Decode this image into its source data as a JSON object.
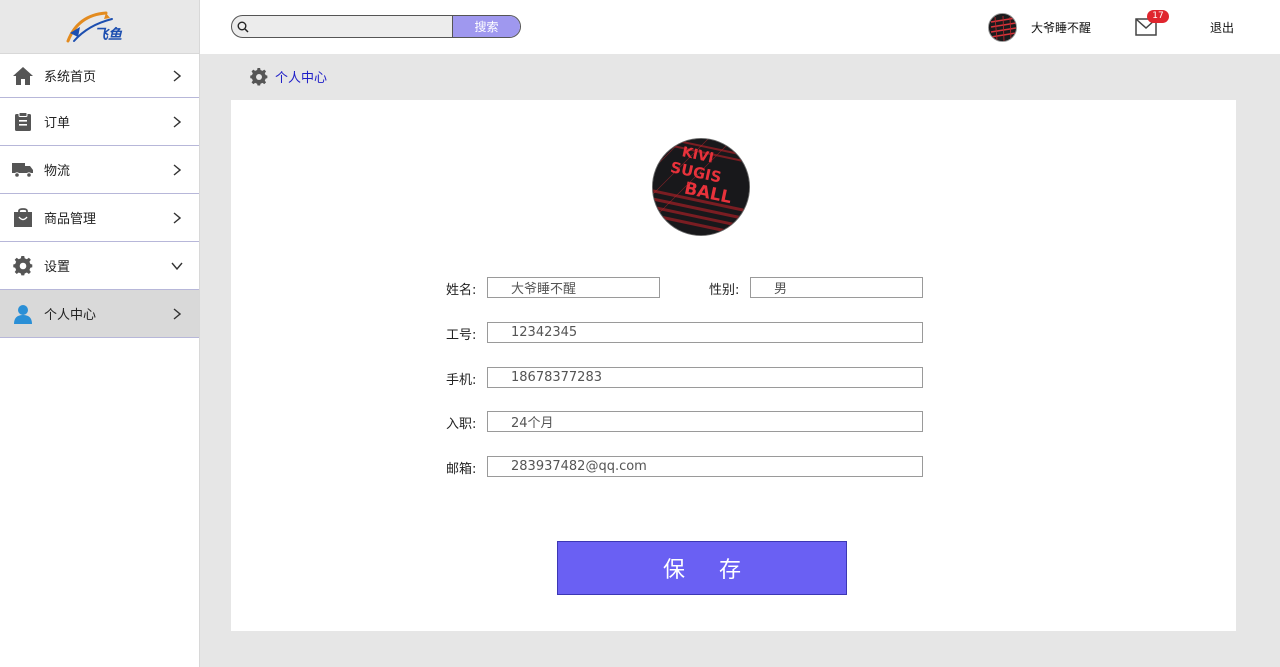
{
  "brand": {
    "logo_text": "飞鱼",
    "logo_colors": {
      "orange": "#e38b1f",
      "blue": "#1d4fb0"
    }
  },
  "sidebar": {
    "items": [
      {
        "label": "系统首页",
        "icon": "home-icon",
        "chevron": "right"
      },
      {
        "label": "订单",
        "icon": "clipboard-icon",
        "chevron": "right"
      },
      {
        "label": "物流",
        "icon": "truck-icon",
        "chevron": "right"
      },
      {
        "label": "商品管理",
        "icon": "shopping-bag-icon",
        "chevron": "right"
      },
      {
        "label": "设置",
        "icon": "gear-icon",
        "chevron": "down"
      },
      {
        "label": "个人中心",
        "icon": "user-icon",
        "chevron": "right",
        "active": true
      }
    ]
  },
  "header": {
    "search": {
      "placeholder": "",
      "button_label": "搜索"
    },
    "user_name": "大爷睡不醒",
    "notifications_count": "17",
    "logout_label": "退出"
  },
  "breadcrumb": {
    "label": "个人中心",
    "icon": "gear-icon"
  },
  "profile": {
    "avatar_text": [
      "KIVI",
      "SUGIS",
      "BALL"
    ],
    "fields": {
      "name": {
        "label": "姓名:",
        "value": "大爷睡不醒"
      },
      "gender": {
        "label": "性别:",
        "value": "男"
      },
      "employee_id": {
        "label": "工号:",
        "value": "12342345"
      },
      "phone": {
        "label": "手机:",
        "value": "18678377283"
      },
      "tenure": {
        "label": "入职:",
        "value": "24个月"
      },
      "email": {
        "label": "邮箱:",
        "value": "283937482@qq.com"
      }
    },
    "save_label": "保存"
  },
  "colors": {
    "accent": "#6a60f3",
    "search_button": "#9f98ef",
    "breadcrumb_text": "#1e1ec8",
    "badge": "#e0262e",
    "sidebar_icon_active": "#2a8fd6"
  }
}
